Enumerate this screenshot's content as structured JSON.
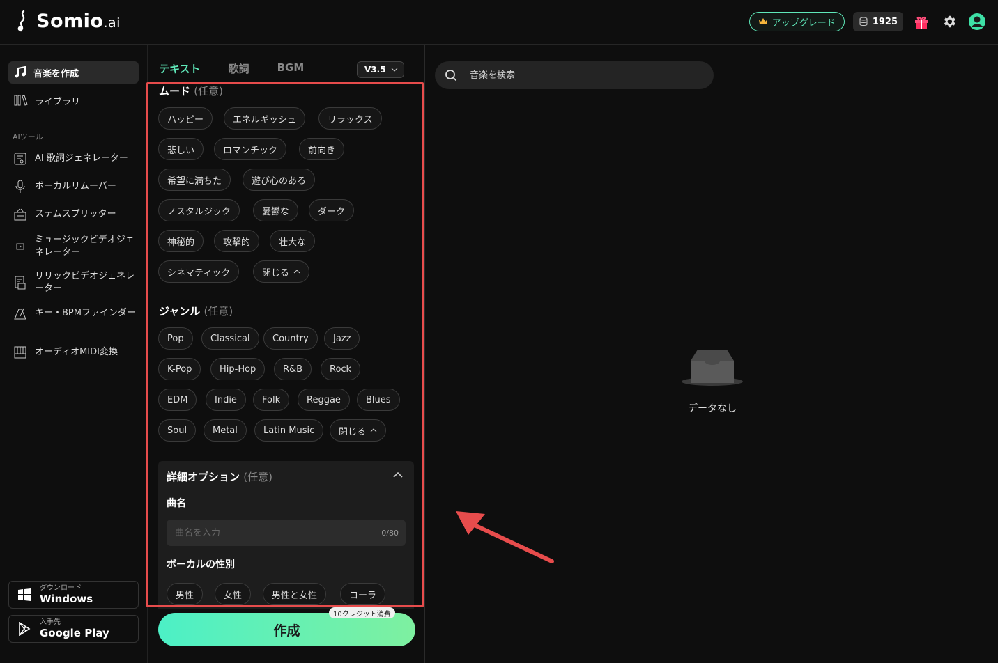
{
  "brand": {
    "name": "Somio",
    "suffix": ".ai"
  },
  "topbar": {
    "upgrade_label": "アップグレード",
    "credits": "1925"
  },
  "sidebar": {
    "primary": [
      {
        "label": "音楽を作成",
        "icon": "music-note-icon"
      },
      {
        "label": "ライブラリ",
        "icon": "library-icon"
      }
    ],
    "section_label": "AIツール",
    "tools": [
      {
        "label": "AI 歌詞ジェネレーター",
        "icon": "lyrics-icon"
      },
      {
        "label": "ボーカルリムーバー",
        "icon": "microphone-icon"
      },
      {
        "label": "ステムスプリッター",
        "icon": "stems-icon"
      },
      {
        "label": "ミュージックビデオジェネレーター",
        "icon": "music-video-icon"
      },
      {
        "label": "リリックビデオジェネレーター",
        "icon": "lyric-video-icon"
      },
      {
        "label": "キー・BPMファインダー",
        "icon": "key-bpm-icon"
      },
      {
        "label": "オーディオMIDI変換",
        "icon": "midi-icon"
      }
    ],
    "downloads": [
      {
        "small": "ダウンロード",
        "big": "Windows",
        "icon": "windows-icon"
      },
      {
        "small": "入手先",
        "big": "Google Play",
        "icon": "google-play-icon"
      }
    ]
  },
  "panel": {
    "tabs": [
      "テキスト",
      "歌詞",
      "BGM"
    ],
    "active_tab": "テキスト",
    "version": "V3.5",
    "mood_title": "ムード",
    "optional": "(任意)",
    "moods": [
      "ハッピー",
      "エネルギッシュ",
      "リラックス",
      "悲しい",
      "ロマンチック",
      "前向き",
      "希望に満ちた",
      "遊び心のある",
      "ノスタルジック",
      "憂鬱な",
      "ダーク",
      "神秘的",
      "攻撃的",
      "壮大な",
      "シネマティック"
    ],
    "collapse_label": "閉じる",
    "genre_title": "ジャンル",
    "genres": [
      "Pop",
      "Classical",
      "Country",
      "Jazz",
      "K-Pop",
      "Hip-Hop",
      "R&B",
      "Rock",
      "EDM",
      "Indie",
      "Folk",
      "Reggae",
      "Blues",
      "Soul",
      "Metal",
      "Latin Music"
    ],
    "advanced": {
      "title": "詳細オプション",
      "song_title_label": "曲名",
      "song_title_placeholder": "曲名を入力",
      "counter": "0/80",
      "vocal_label": "ボーカルの性別",
      "vocal_options": [
        "男性",
        "女性",
        "男性と女性",
        "コーラ"
      ]
    },
    "credit_cost": "10クレジット消費",
    "create_label": "作成"
  },
  "main": {
    "search_placeholder": "音楽を検索",
    "empty_text": "データなし"
  },
  "colors": {
    "accent": "#5fe8b9",
    "highlight": "#e74c4c",
    "background": "#0e0e0e"
  }
}
